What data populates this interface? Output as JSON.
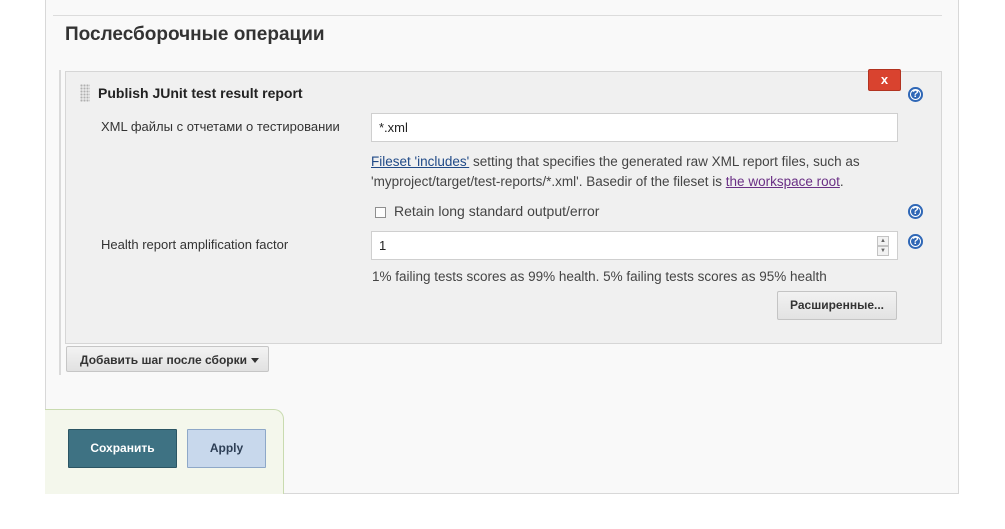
{
  "section": {
    "title": "Послесборочные операции"
  },
  "step": {
    "title": "Publish JUnit test result report",
    "delete_label": "x",
    "xml_field": {
      "label": "XML файлы с отчетами о тестировании",
      "value": "*.xml"
    },
    "xml_help": {
      "link1": "Fileset 'includes'",
      "text1": " setting that specifies the generated raw XML report files, such as 'myproject/target/test-reports/*.xml'. Basedir of the fileset is ",
      "link2": "the workspace root",
      "text2": "."
    },
    "retain_checkbox": {
      "label": "Retain long standard output/error",
      "checked": false
    },
    "health_field": {
      "label": "Health report amplification factor",
      "value": "1",
      "help": "1% failing tests scores as 99% health. 5% failing tests scores as 95% health"
    },
    "advanced_label": "Расширенные..."
  },
  "add_step_label": "Добавить шаг после сборки",
  "actions": {
    "save_label": "Сохранить",
    "apply_label": "Apply"
  },
  "icons": {
    "help": "help-icon",
    "delete": "close-icon",
    "dropdown": "chevron-down-icon"
  }
}
